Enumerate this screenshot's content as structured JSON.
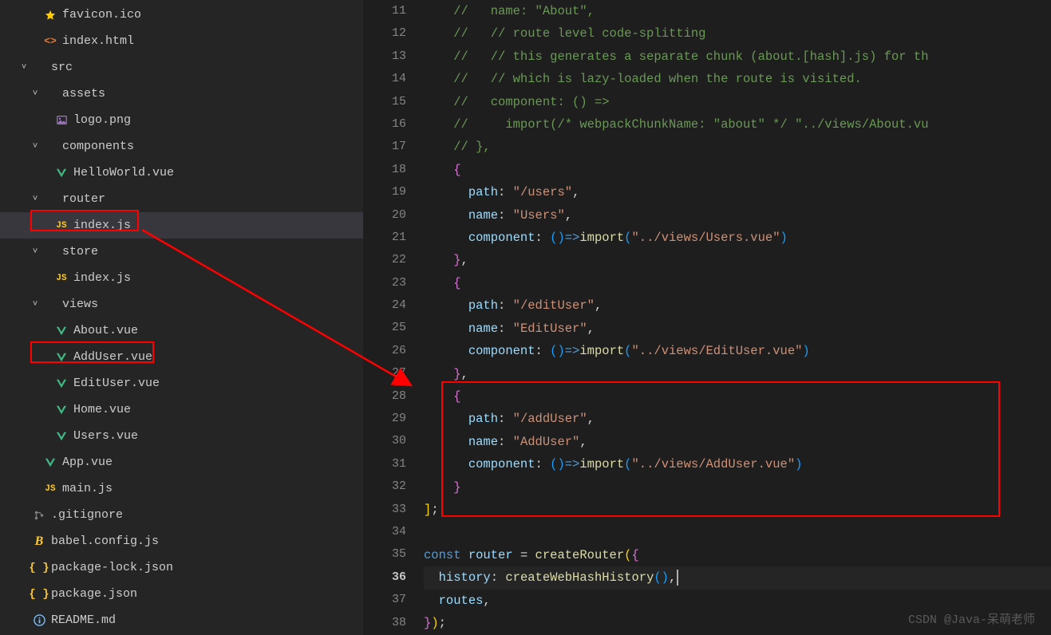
{
  "watermark": "CSDN @Java-呆萌老师",
  "sidebar": {
    "items": [
      {
        "indent": 36,
        "chev": "",
        "iconType": "star",
        "label": "favicon.ico"
      },
      {
        "indent": 36,
        "chev": "",
        "iconType": "html",
        "iconText": "<>",
        "label": "index.html"
      },
      {
        "indent": 22,
        "chev": "˅",
        "iconType": "",
        "label": "src"
      },
      {
        "indent": 36,
        "chev": "˅",
        "iconType": "",
        "label": "assets"
      },
      {
        "indent": 50,
        "chev": "",
        "iconType": "img",
        "label": "logo.png"
      },
      {
        "indent": 36,
        "chev": "˅",
        "iconType": "",
        "label": "components"
      },
      {
        "indent": 50,
        "chev": "",
        "iconType": "vue",
        "label": "HelloWorld.vue"
      },
      {
        "indent": 36,
        "chev": "˅",
        "iconType": "",
        "label": "router"
      },
      {
        "indent": 50,
        "chev": "",
        "iconType": "js",
        "iconText": "JS",
        "label": "index.js",
        "selected": true
      },
      {
        "indent": 36,
        "chev": "˅",
        "iconType": "",
        "label": "store"
      },
      {
        "indent": 50,
        "chev": "",
        "iconType": "js",
        "iconText": "JS",
        "label": "index.js"
      },
      {
        "indent": 36,
        "chev": "˅",
        "iconType": "",
        "label": "views"
      },
      {
        "indent": 50,
        "chev": "",
        "iconType": "vue",
        "label": "About.vue"
      },
      {
        "indent": 50,
        "chev": "",
        "iconType": "vue",
        "label": "AddUser.vue"
      },
      {
        "indent": 50,
        "chev": "",
        "iconType": "vue",
        "label": "EditUser.vue"
      },
      {
        "indent": 50,
        "chev": "",
        "iconType": "vue",
        "label": "Home.vue"
      },
      {
        "indent": 50,
        "chev": "",
        "iconType": "vue",
        "label": "Users.vue"
      },
      {
        "indent": 36,
        "chev": "",
        "iconType": "vue",
        "label": "App.vue"
      },
      {
        "indent": 36,
        "chev": "",
        "iconType": "js",
        "iconText": "JS",
        "label": "main.js"
      },
      {
        "indent": 22,
        "chev": "",
        "iconType": "git",
        "label": ".gitignore"
      },
      {
        "indent": 22,
        "chev": "",
        "iconType": "babel",
        "iconText": "B",
        "label": "babel.config.js"
      },
      {
        "indent": 22,
        "chev": "",
        "iconType": "json",
        "iconText": "{ }",
        "label": "package-lock.json"
      },
      {
        "indent": 22,
        "chev": "",
        "iconType": "json",
        "iconText": "{ }",
        "label": "package.json"
      },
      {
        "indent": 22,
        "chev": "",
        "iconType": "info",
        "label": "README.md"
      }
    ]
  },
  "gutter": {
    "start": 11,
    "end": 38,
    "current": 36
  },
  "code": {
    "lines": [
      [
        {
          "t": "    ",
          "c": ""
        },
        {
          "t": "//   name: \"About\",",
          "c": "c-comment"
        }
      ],
      [
        {
          "t": "    ",
          "c": ""
        },
        {
          "t": "//   // route level code-splitting",
          "c": "c-comment"
        }
      ],
      [
        {
          "t": "    ",
          "c": ""
        },
        {
          "t": "//   // this generates a separate chunk (about.[hash].js) for th",
          "c": "c-comment"
        }
      ],
      [
        {
          "t": "    ",
          "c": ""
        },
        {
          "t": "//   // which is lazy-loaded when the route is visited.",
          "c": "c-comment"
        }
      ],
      [
        {
          "t": "    ",
          "c": ""
        },
        {
          "t": "//   component: () =>",
          "c": "c-comment"
        }
      ],
      [
        {
          "t": "    ",
          "c": ""
        },
        {
          "t": "//     import(/* webpackChunkName: \"about\" */ \"../views/About.vu",
          "c": "c-comment"
        }
      ],
      [
        {
          "t": "    ",
          "c": ""
        },
        {
          "t": "// },",
          "c": "c-comment"
        }
      ],
      [
        {
          "t": "    ",
          "c": ""
        },
        {
          "t": "{",
          "c": "c-brace2"
        }
      ],
      [
        {
          "t": "      ",
          "c": ""
        },
        {
          "t": "path",
          "c": "c-prop"
        },
        {
          "t": ": ",
          "c": "c-punct"
        },
        {
          "t": "\"/users\"",
          "c": "c-string"
        },
        {
          "t": ",",
          "c": "c-punct"
        }
      ],
      [
        {
          "t": "      ",
          "c": ""
        },
        {
          "t": "name",
          "c": "c-prop"
        },
        {
          "t": ": ",
          "c": "c-punct"
        },
        {
          "t": "\"Users\"",
          "c": "c-string"
        },
        {
          "t": ",",
          "c": "c-punct"
        }
      ],
      [
        {
          "t": "      ",
          "c": ""
        },
        {
          "t": "component",
          "c": "c-prop"
        },
        {
          "t": ": ",
          "c": "c-punct"
        },
        {
          "t": "()",
          "c": "c-brace3"
        },
        {
          "t": "=>",
          "c": "c-keyword"
        },
        {
          "t": "import",
          "c": "c-func"
        },
        {
          "t": "(",
          "c": "c-brace3"
        },
        {
          "t": "\"../views/Users.vue\"",
          "c": "c-string"
        },
        {
          "t": ")",
          "c": "c-brace3"
        }
      ],
      [
        {
          "t": "    ",
          "c": ""
        },
        {
          "t": "}",
          "c": "c-brace2"
        },
        {
          "t": ",",
          "c": "c-punct"
        }
      ],
      [
        {
          "t": "    ",
          "c": ""
        },
        {
          "t": "{",
          "c": "c-brace2"
        }
      ],
      [
        {
          "t": "      ",
          "c": ""
        },
        {
          "t": "path",
          "c": "c-prop"
        },
        {
          "t": ": ",
          "c": "c-punct"
        },
        {
          "t": "\"/editUser\"",
          "c": "c-string"
        },
        {
          "t": ",",
          "c": "c-punct"
        }
      ],
      [
        {
          "t": "      ",
          "c": ""
        },
        {
          "t": "name",
          "c": "c-prop"
        },
        {
          "t": ": ",
          "c": "c-punct"
        },
        {
          "t": "\"EditUser\"",
          "c": "c-string"
        },
        {
          "t": ",",
          "c": "c-punct"
        }
      ],
      [
        {
          "t": "      ",
          "c": ""
        },
        {
          "t": "component",
          "c": "c-prop"
        },
        {
          "t": ": ",
          "c": "c-punct"
        },
        {
          "t": "()",
          "c": "c-brace3"
        },
        {
          "t": "=>",
          "c": "c-keyword"
        },
        {
          "t": "import",
          "c": "c-func"
        },
        {
          "t": "(",
          "c": "c-brace3"
        },
        {
          "t": "\"../views/EditUser.vue\"",
          "c": "c-string"
        },
        {
          "t": ")",
          "c": "c-brace3"
        }
      ],
      [
        {
          "t": "    ",
          "c": ""
        },
        {
          "t": "}",
          "c": "c-brace2"
        },
        {
          "t": ",",
          "c": "c-punct"
        }
      ],
      [
        {
          "t": "    ",
          "c": ""
        },
        {
          "t": "{",
          "c": "c-brace2"
        }
      ],
      [
        {
          "t": "      ",
          "c": ""
        },
        {
          "t": "path",
          "c": "c-prop"
        },
        {
          "t": ": ",
          "c": "c-punct"
        },
        {
          "t": "\"/addUser\"",
          "c": "c-string"
        },
        {
          "t": ",",
          "c": "c-punct"
        }
      ],
      [
        {
          "t": "      ",
          "c": ""
        },
        {
          "t": "name",
          "c": "c-prop"
        },
        {
          "t": ": ",
          "c": "c-punct"
        },
        {
          "t": "\"AddUser\"",
          "c": "c-string"
        },
        {
          "t": ",",
          "c": "c-punct"
        }
      ],
      [
        {
          "t": "      ",
          "c": ""
        },
        {
          "t": "component",
          "c": "c-prop"
        },
        {
          "t": ": ",
          "c": "c-punct"
        },
        {
          "t": "()",
          "c": "c-brace3"
        },
        {
          "t": "=>",
          "c": "c-keyword"
        },
        {
          "t": "import",
          "c": "c-func"
        },
        {
          "t": "(",
          "c": "c-brace3"
        },
        {
          "t": "\"../views/AddUser.vue\"",
          "c": "c-string"
        },
        {
          "t": ")",
          "c": "c-brace3"
        }
      ],
      [
        {
          "t": "    ",
          "c": ""
        },
        {
          "t": "}",
          "c": "c-brace2"
        }
      ],
      [
        {
          "t": "]",
          "c": "c-brace"
        },
        {
          "t": ";",
          "c": "c-punct"
        }
      ],
      [
        {
          "t": "",
          "c": ""
        }
      ],
      [
        {
          "t": "const",
          "c": "c-keyword"
        },
        {
          "t": " ",
          "c": ""
        },
        {
          "t": "router",
          "c": "c-prop"
        },
        {
          "t": " = ",
          "c": "c-punct"
        },
        {
          "t": "createRouter",
          "c": "c-func"
        },
        {
          "t": "(",
          "c": "c-brace"
        },
        {
          "t": "{",
          "c": "c-brace2"
        }
      ],
      [
        {
          "t": "  ",
          "c": ""
        },
        {
          "t": "history",
          "c": "c-prop"
        },
        {
          "t": ": ",
          "c": "c-punct"
        },
        {
          "t": "createWebHashHistory",
          "c": "c-func"
        },
        {
          "t": "()",
          "c": "c-brace3"
        },
        {
          "t": ",",
          "c": "c-punct"
        }
      ],
      [
        {
          "t": "  ",
          "c": ""
        },
        {
          "t": "routes",
          "c": "c-prop"
        },
        {
          "t": ",",
          "c": "c-punct"
        }
      ],
      [
        {
          "t": "}",
          "c": "c-brace2"
        },
        {
          "t": ")",
          "c": "c-brace"
        },
        {
          "t": ";",
          "c": "c-punct"
        }
      ]
    ]
  }
}
